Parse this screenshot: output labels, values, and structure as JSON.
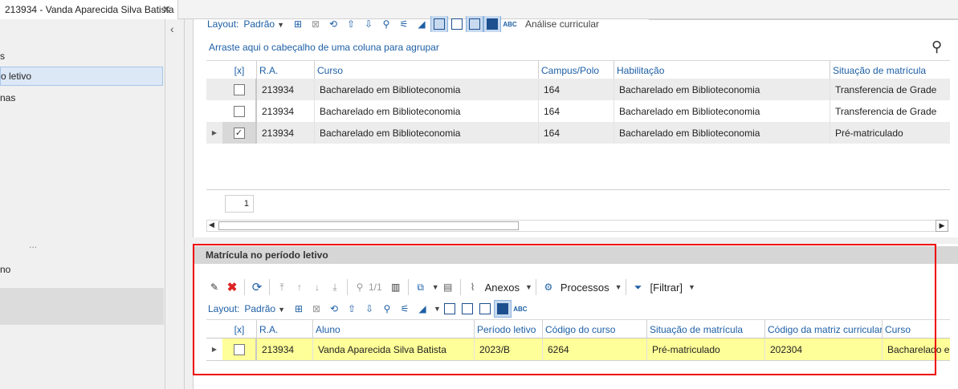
{
  "tab": {
    "title": "213934 - Vanda Aparecida Silva Batista",
    "close": "✕"
  },
  "left_nav": {
    "items": [
      "s",
      "o letivo",
      "nas",
      "no"
    ],
    "dots": "..."
  },
  "top_toolbar": {
    "layout_label": "Layout:",
    "layout_value": "Padrão",
    "analysis_label": "Análise curricular"
  },
  "top_grid": {
    "group_hint": "Arraste aqui o cabeçalho de uma coluna para agrupar",
    "columns": [
      "[x]",
      "R.A.",
      "Curso",
      "Campus/Polo",
      "Habilitação",
      "Situação de matrícula"
    ],
    "rows": [
      {
        "checked": false,
        "ra": "213934",
        "curso": "Bacharelado em Biblioteconomia",
        "campus": "164",
        "habilitacao": "Bacharelado em Biblioteconomia",
        "situacao": "Transferencia de Grade"
      },
      {
        "checked": false,
        "ra": "213934",
        "curso": "Bacharelado em Biblioteconomia",
        "campus": "164",
        "habilitacao": "Bacharelado em Biblioteconomia",
        "situacao": "Transferencia de Grade"
      },
      {
        "checked": true,
        "ra": "213934",
        "curso": "Bacharelado em Biblioteconomia",
        "campus": "164",
        "habilitacao": "Bacharelado em Biblioteconomia",
        "situacao": "Pré-matriculado"
      }
    ],
    "page": "1"
  },
  "bottom_section": {
    "title": "Matrícula no período letivo",
    "toolbar": {
      "page_info": "1/1",
      "anexos": "Anexos",
      "processos": "Processos",
      "filtrar": "[Filtrar]",
      "layout_label": "Layout:",
      "layout_value": "Padrão"
    },
    "columns": [
      "[x]",
      "R.A.",
      "Aluno",
      "Período letivo",
      "Código do curso",
      "Situação de matrícula",
      "Código da matriz curricular",
      "Curso"
    ],
    "row": {
      "checked": false,
      "ra": "213934",
      "aluno": "Vanda Aparecida Silva Batista",
      "periodo": "2023/B",
      "codigo_curso": "6264",
      "situacao": "Pré-matriculado",
      "codigo_matriz": "202304",
      "curso": "Bacharelado em"
    },
    "highlight_color": "#ffff99"
  }
}
